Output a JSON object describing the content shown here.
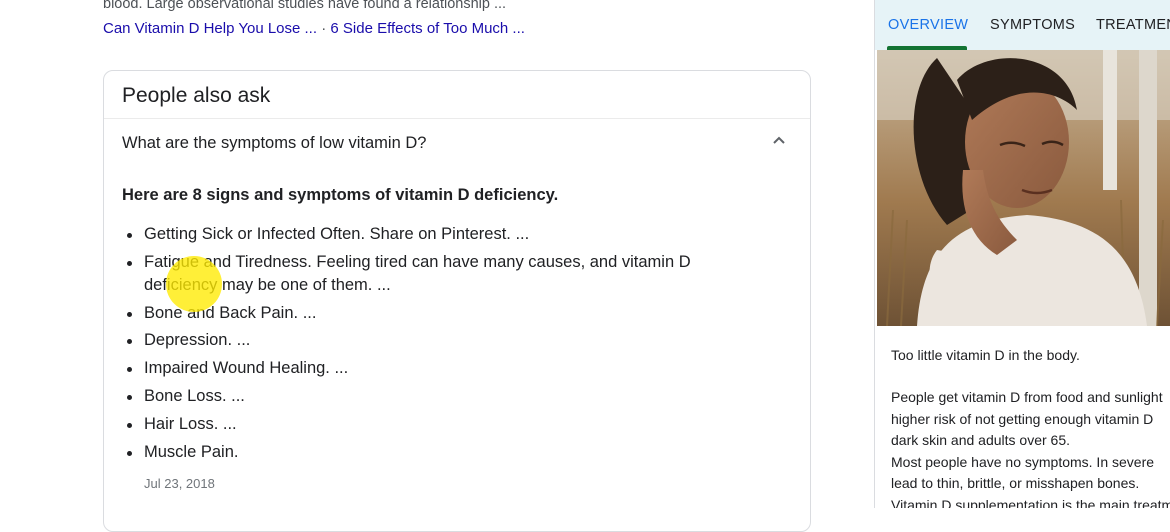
{
  "snippet": {
    "text": "blood. Large observational studies have found a relationship ...",
    "links": [
      "Can Vitamin D Help You Lose ...",
      "6 Side Effects of Too Much ..."
    ],
    "separator": "·"
  },
  "paa": {
    "title": "People also ask",
    "question": "What are the symptoms of low vitamin D?",
    "answer_heading": "Here are 8 signs and symptoms of vitamin D deficiency.",
    "items": [
      "Getting Sick or Infected Often. Share on Pinterest. ...",
      "Fatigue and Tiredness. Feeling tired can have many causes, and vitamin D deficiency may be one of them. ...",
      "Bone and Back Pain. ...",
      "Depression. ...",
      "Impaired Wound Healing. ...",
      "Bone Loss. ...",
      "Hair Loss. ...",
      "Muscle Pain."
    ],
    "date": "Jul 23, 2018"
  },
  "knowledge_panel": {
    "tabs": [
      "OVERVIEW",
      "SYMPTOMS",
      "TREATMENTS"
    ],
    "active_tab": "OVERVIEW",
    "caption": "Too little vitamin D in the body.",
    "body_lines": [
      "People get vitamin D from food and sunlight",
      "higher risk of not getting enough vitamin D",
      "dark skin and adults over 65.",
      "Most people have no symptoms. In severe",
      "lead to thin, brittle, or misshapen bones.",
      "Vitamin D supplementation is the main treatment"
    ]
  },
  "colors": {
    "link": "#1a0dab",
    "tab_active": "#1a73e8",
    "tab_bg": "#e6f3f7",
    "highlight": "#ffeb00"
  },
  "icons": {
    "expand": "chevron-up-icon"
  }
}
